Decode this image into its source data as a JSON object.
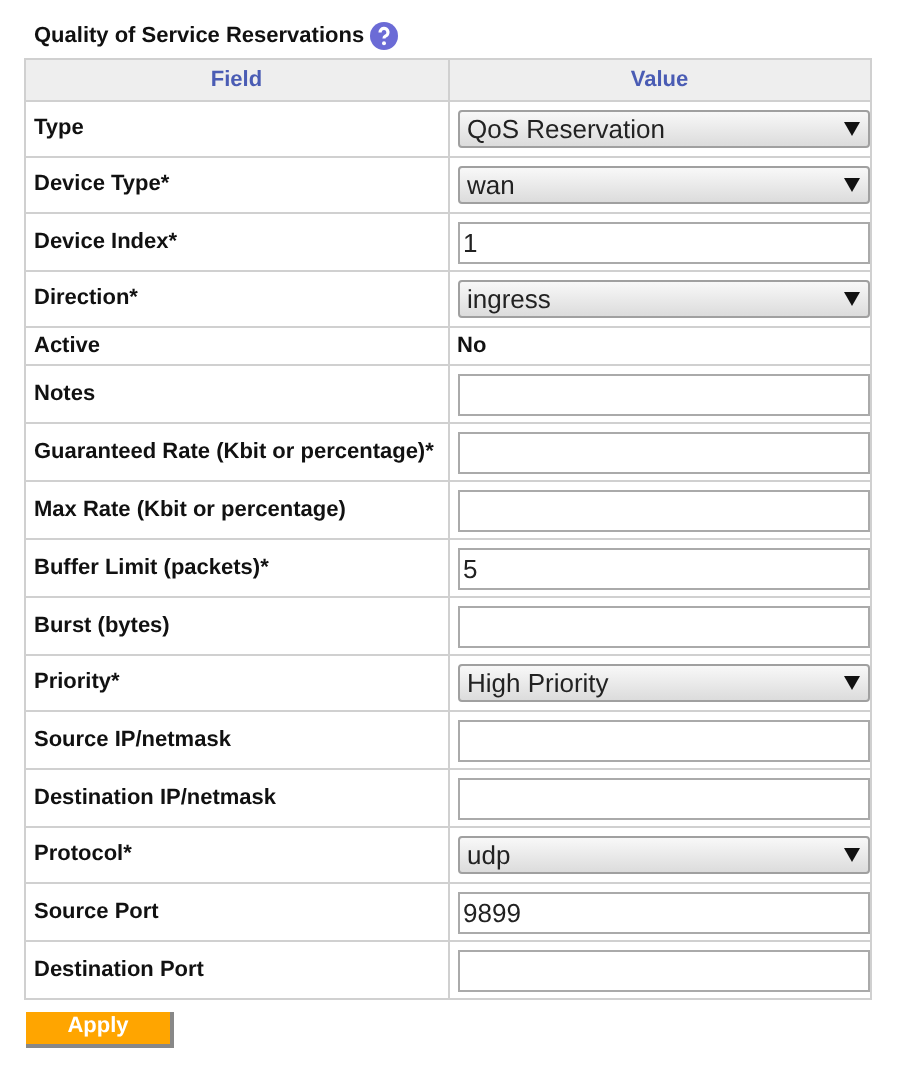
{
  "title": "Quality of Service Reservations",
  "columns": [
    "Field",
    "Value"
  ],
  "rows": [
    {
      "label": "Type",
      "kind": "select",
      "value": "QoS Reservation"
    },
    {
      "label": "Device Type*",
      "kind": "select",
      "value": "wan"
    },
    {
      "label": "Device Index*",
      "kind": "input",
      "value": "1"
    },
    {
      "label": "Direction*",
      "kind": "select",
      "value": "ingress"
    },
    {
      "label": "Active",
      "kind": "text",
      "value": "No"
    },
    {
      "label": "Notes",
      "kind": "input",
      "value": ""
    },
    {
      "label": "Guaranteed Rate (Kbit or percentage)*",
      "kind": "input",
      "value": ""
    },
    {
      "label": "Max Rate (Kbit or percentage)",
      "kind": "input",
      "value": ""
    },
    {
      "label": "Buffer Limit (packets)*",
      "kind": "input",
      "value": "5"
    },
    {
      "label": "Burst (bytes)",
      "kind": "input",
      "value": ""
    },
    {
      "label": "Priority*",
      "kind": "select",
      "value": "High Priority"
    },
    {
      "label": "Source IP/netmask",
      "kind": "input",
      "value": ""
    },
    {
      "label": "Destination IP/netmask",
      "kind": "input",
      "value": ""
    },
    {
      "label": "Protocol*",
      "kind": "select",
      "value": "udp"
    },
    {
      "label": "Source Port",
      "kind": "input",
      "value": "9899"
    },
    {
      "label": "Destination Port",
      "kind": "input",
      "value": ""
    }
  ],
  "apply_button": "Apply"
}
